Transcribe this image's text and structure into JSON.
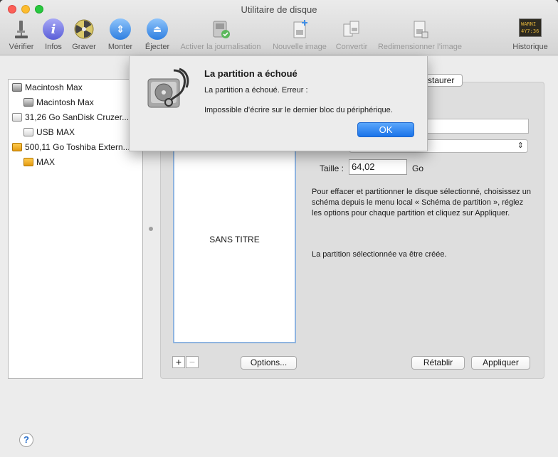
{
  "window": {
    "title": "Utilitaire de disque"
  },
  "toolbar": {
    "verify": "Vérifier",
    "info": "Infos",
    "burn": "Graver",
    "mount": "Monter",
    "eject": "Éjecter",
    "journal": "Activer la journalisation",
    "new_image": "Nouvelle image",
    "convert": "Convertir",
    "resize": "Redimensionner l’image",
    "history": "Historique",
    "history_icon_text": "WARNI\n4Y7:36"
  },
  "sidebar": {
    "items": [
      {
        "label": "Macintosh Max",
        "level": 0,
        "icon": "gray"
      },
      {
        "label": "Macintosh Max",
        "level": 1,
        "icon": "gray"
      },
      {
        "label": "31,26 Go SanDisk Cruzer...",
        "level": 0,
        "icon": "white"
      },
      {
        "label": "USB MAX",
        "level": 1,
        "icon": "white"
      },
      {
        "label": "500,11 Go Toshiba Extern...",
        "level": 0,
        "icon": "orange"
      },
      {
        "label": "MAX",
        "level": 1,
        "icon": "orange"
      }
    ]
  },
  "main": {
    "restore_tab": "staurer",
    "partition_name": "SANS TITRE",
    "size_label": "Taille :",
    "size_value": "64,02",
    "size_unit": "Go",
    "info": "Pour effacer et partitionner le disque sélectionné, choisissez un schéma depuis le menu local « Schéma de partition », réglez les options pour chaque partition et cliquez sur Appliquer.",
    "status": "La partition sélectionnée va être créée.",
    "add": "+",
    "remove": "−",
    "options_button": "Options...",
    "revert_button": "Rétablir",
    "apply_button": "Appliquer"
  },
  "dialog": {
    "title": "La partition a échoué",
    "message1": "La partition a échoué. Erreur :",
    "message2": "Impossible d’écrire sur le dernier bloc du périphérique.",
    "ok": "OK"
  },
  "help": "?"
}
